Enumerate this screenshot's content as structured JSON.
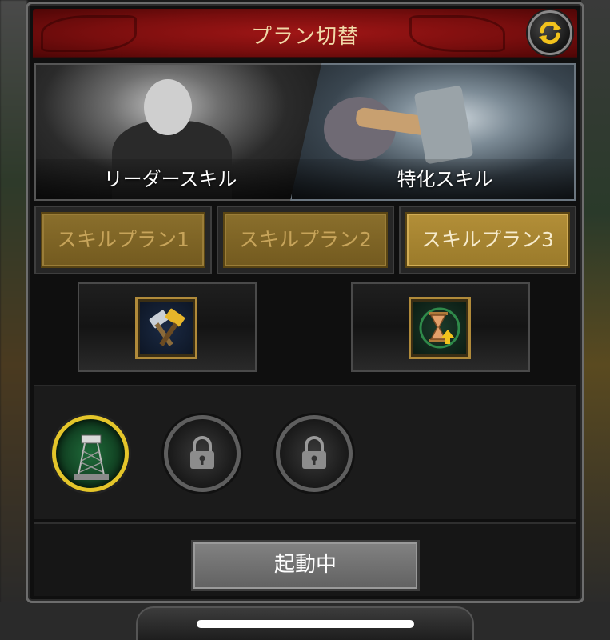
{
  "dialog": {
    "title": "プラン切替",
    "refresh_icon": "refresh-icon"
  },
  "skill_tabs": [
    {
      "label": "リーダースキル",
      "selected": false
    },
    {
      "label": "特化スキル",
      "selected": true
    }
  ],
  "plans": [
    {
      "label": "スキルプラン1",
      "active": false
    },
    {
      "label": "スキルプラン2",
      "active": false
    },
    {
      "label": "スキルプラン3",
      "active": true
    }
  ],
  "equipped_skills": [
    {
      "icon": "crossed-hammers-icon"
    },
    {
      "icon": "hourglass-upgrade-icon"
    }
  ],
  "talents": [
    {
      "icon": "tower-icon",
      "state": "active"
    },
    {
      "icon": "lock-icon",
      "state": "locked"
    },
    {
      "icon": "lock-icon",
      "state": "locked"
    }
  ],
  "footer": {
    "action_label": "起動中"
  },
  "colors": {
    "title_bar": "#8e1010",
    "plan_gold": "#9a7a2a",
    "active_ring": "#e4c52a",
    "action_button": "#6e6e6e"
  }
}
